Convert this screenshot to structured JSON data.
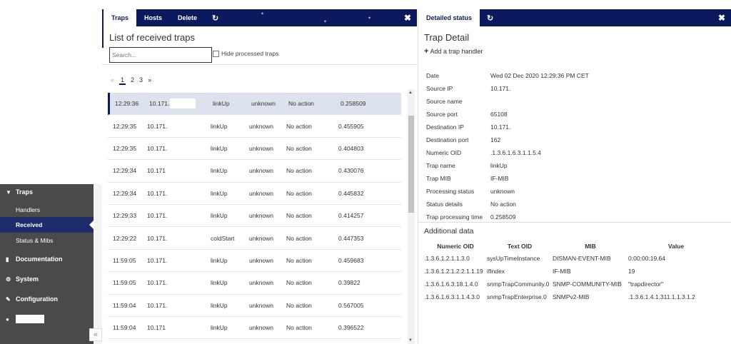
{
  "nav": {
    "traps": "Traps",
    "handlers": "Handlers",
    "received": "Received",
    "status_mibs": "Status & Mibs",
    "documentation": "Documentation",
    "system": "System",
    "configuration": "Configuration",
    "collapse": "«"
  },
  "traps_panel": {
    "tabs": [
      "Traps",
      "Hosts",
      "Delete"
    ],
    "refresh_icon": "↻",
    "close_icon": "✖",
    "title": "List of received traps",
    "search_placeholder": "Search...",
    "hide_processed_label": "Hide processed traps",
    "pager": {
      "prev": "«",
      "pages": [
        "1",
        "2",
        "3"
      ],
      "next": "»",
      "current": "1"
    },
    "rows": [
      {
        "time": "12:29:36",
        "ip": "10.171.",
        "trap": "linkUp",
        "status": "unknown",
        "action": "No action",
        "duration": "0.258509"
      },
      {
        "time": "12:29:35",
        "ip": "10.171.",
        "trap": "linkUp",
        "status": "unknown",
        "action": "No action",
        "duration": "0.455905"
      },
      {
        "time": "12:29:35",
        "ip": "10.171.",
        "trap": "linkUp",
        "status": "unknown",
        "action": "No action",
        "duration": "0.404803"
      },
      {
        "time": "12:29:34",
        "ip": "10.171",
        "trap": "linkUp",
        "status": "unknown",
        "action": "No action",
        "duration": "0.430076"
      },
      {
        "time": "12:29:34",
        "ip": "10.171.",
        "trap": "linkUp",
        "status": "unknown",
        "action": "No action",
        "duration": "0.445832"
      },
      {
        "time": "12:29:33",
        "ip": "10.171.",
        "trap": "linkUp",
        "status": "unknown",
        "action": "No action",
        "duration": "0.414257"
      },
      {
        "time": "12:29:22",
        "ip": "10.171.:",
        "trap": "coldStart",
        "status": "unknown",
        "action": "No action",
        "duration": "0.447353"
      },
      {
        "time": "11:59:05",
        "ip": "10.171.",
        "trap": "linkUp",
        "status": "unknown",
        "action": "No action",
        "duration": "0.459683"
      },
      {
        "time": "11:59:05",
        "ip": "10.171.",
        "trap": "linkUp",
        "status": "unknown",
        "action": "No action",
        "duration": "0.39822"
      },
      {
        "time": "11:59:04",
        "ip": "10.171.",
        "trap": "linkUp",
        "status": "unknown",
        "action": "No action",
        "duration": "0.567005"
      },
      {
        "time": "11:59:04",
        "ip": "10.171",
        "trap": "linkUp",
        "status": "unknown",
        "action": "No action",
        "duration": "0.396522"
      }
    ]
  },
  "detail_panel": {
    "tab": "Detailed status",
    "refresh_icon": "↻",
    "close_icon": "✖",
    "title": "Trap Detail",
    "add_handler_label": "Add a trap handler",
    "fields": [
      {
        "k": "Date",
        "v": "Wed 02 Dec 2020 12:29:36 PM CET"
      },
      {
        "k": "Source IP",
        "v": "10.171."
      },
      {
        "k": "Source name",
        "v": ""
      },
      {
        "k": "Source port",
        "v": "65108"
      },
      {
        "k": "Destination IP",
        "v": "10.171."
      },
      {
        "k": "Destination port",
        "v": "162"
      },
      {
        "k": "Numeric OID",
        "v": ".1.3.6.1.6.3.1.1.5.4"
      },
      {
        "k": "Trap name",
        "v": "linkUp"
      },
      {
        "k": "Trap MIB",
        "v": "IF-MIB"
      },
      {
        "k": "Processing status",
        "v": "unknown"
      },
      {
        "k": "Status details",
        "v": "No action"
      },
      {
        "k": "Trap processing time",
        "v": "0.258509"
      }
    ],
    "additional_title": "Additional data",
    "additional_headers": [
      "Numeric OID",
      "Text OID",
      "MIB",
      "Value"
    ],
    "additional_rows": [
      {
        "oid": ".1.3.6.1.2.1.1.3.0",
        "text": "sysUpTimeInstance",
        "mib": "DISMAN-EVENT-MIB",
        "value": "0:00:00:19.64"
      },
      {
        "oid": ".1.3.6.1.2.1.2.2.1.1.19",
        "text": "ifIndex",
        "mib": "IF-MIB",
        "value": "19"
      },
      {
        "oid": ".1.3.6.1.6.3.18.1.4.0",
        "text": "snmpTrapCommunity.0",
        "mib": "SNMP-COMMUNITY-MIB",
        "value": "\"trapdirector\""
      },
      {
        "oid": ".1.3.6.1.6.3.1.1.4.3.0",
        "text": "snmpTrapEnterprise.0",
        "mib": "SNMPv2-MIB",
        "value": ".1.3.6.1.4.1.311.1.1.3.1.2"
      }
    ]
  }
}
